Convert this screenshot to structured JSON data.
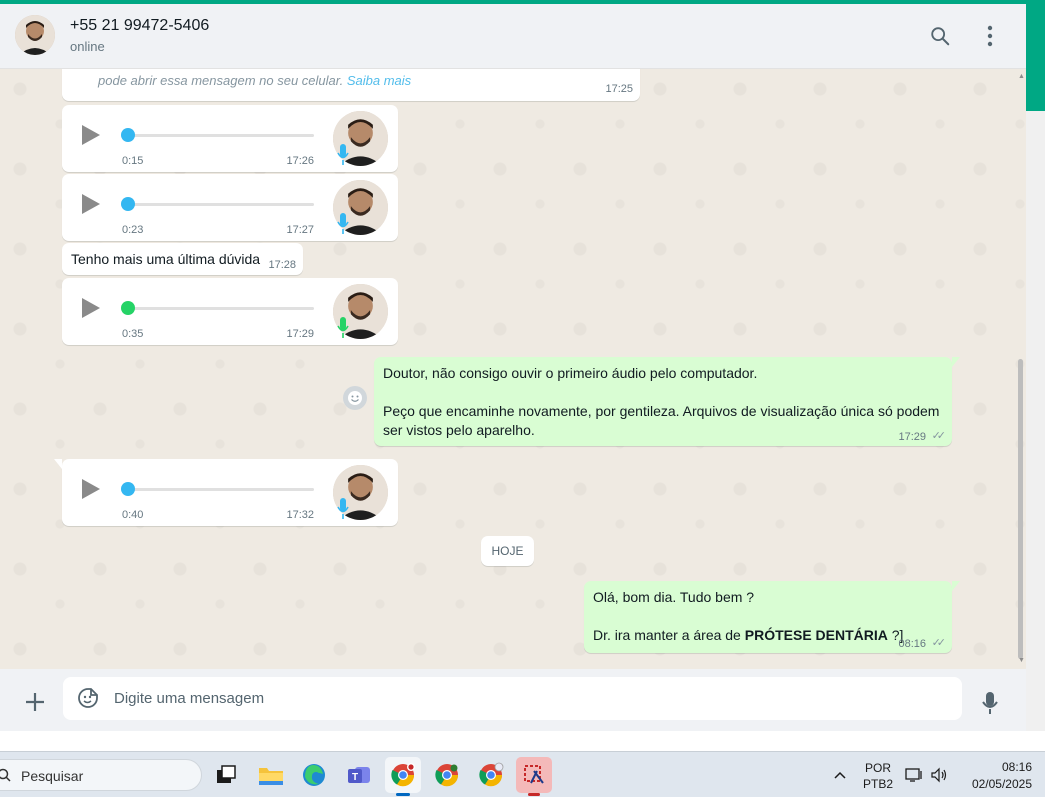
{
  "header": {
    "contact_name": "+55 21 99472-5406",
    "status": "online",
    "search_icon": "search-icon",
    "menu_icon": "kebab-menu-icon"
  },
  "messages": {
    "partial_note_text": "pode abrir essa mensagem no seu celular.",
    "partial_note_link": "Saiba mais",
    "partial_note_time": "17:25",
    "voice1": {
      "duration": "0:15",
      "time": "17:26"
    },
    "voice2": {
      "duration": "0:23",
      "time": "17:27"
    },
    "text1": {
      "text": "Tenho mais uma última dúvida",
      "time": "17:28"
    },
    "voice3": {
      "duration": "0:35",
      "time": "17:29"
    },
    "out1": {
      "line1": "Doutor, não consigo ouvir o primeiro áudio pelo computador.",
      "line2": "Peço que encaminhe novamente, por gentileza. Arquivos de visualização única só podem ser vistos pelo aparelho.",
      "time": "17:29"
    },
    "voice4": {
      "duration": "0:40",
      "time": "17:32"
    },
    "date_divider": "HOJE",
    "out2": {
      "line1": "Olá, bom dia. Tudo bem ?",
      "line2_prefix": "Dr. ira manter a área de ",
      "line2_bold": "PRÓTESE DENTÁRIA",
      "line2_suffix": " ?]",
      "time": "08:16"
    }
  },
  "composer": {
    "placeholder": "Digite uma mensagem"
  },
  "taskbar": {
    "search_label": "Pesquisar",
    "lang_top": "POR",
    "lang_bottom": "PTB2",
    "clock_time": "08:16",
    "clock_date": "02/05/2025"
  },
  "colors": {
    "accent": "#00a884",
    "outgoing_bubble": "#d9fdd3",
    "chat_bg": "#efeae2",
    "voice_blue": "#34b7f1",
    "voice_green": "#25d366"
  }
}
